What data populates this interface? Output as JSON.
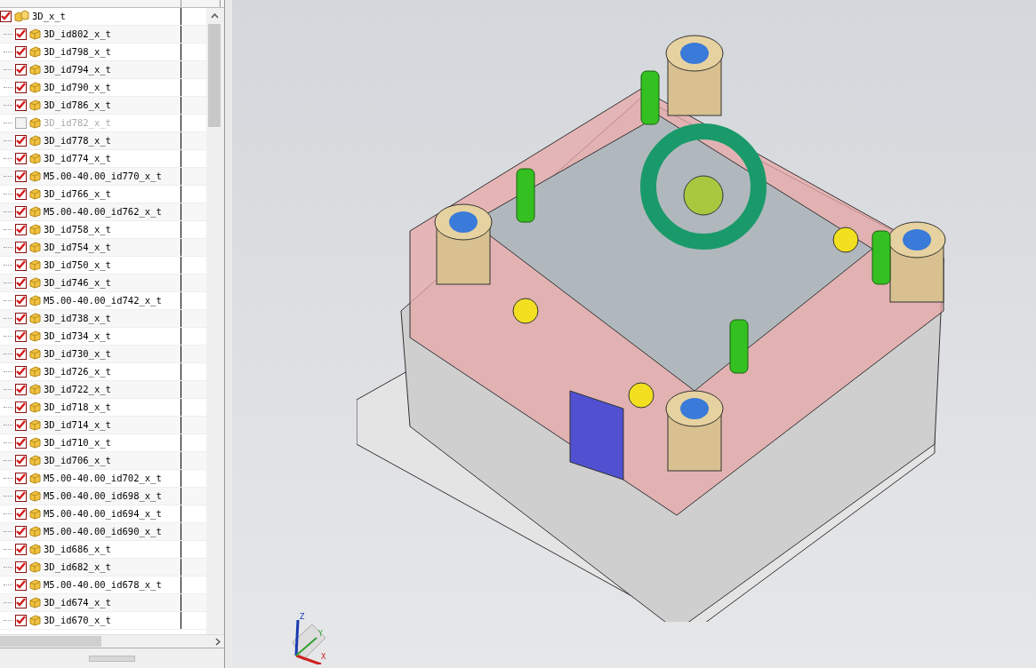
{
  "navigator": {
    "root": {
      "label": "3D_x_t",
      "checked": true,
      "children": [
        {
          "label": "3D_id802_x_t",
          "checked": true
        },
        {
          "label": "3D_id798_x_t",
          "checked": true
        },
        {
          "label": "3D_id794_x_t",
          "checked": true
        },
        {
          "label": "3D_id790_x_t",
          "checked": true
        },
        {
          "label": "3D_id786_x_t",
          "checked": true
        },
        {
          "label": "3D_id782_x_t",
          "checked": false
        },
        {
          "label": "3D_id778_x_t",
          "checked": true
        },
        {
          "label": "3D_id774_x_t",
          "checked": true
        },
        {
          "label": "M5.00-40.00_id770_x_t",
          "checked": true
        },
        {
          "label": "3D_id766_x_t",
          "checked": true
        },
        {
          "label": "M5.00-40.00_id762_x_t",
          "checked": true
        },
        {
          "label": "3D_id758_x_t",
          "checked": true
        },
        {
          "label": "3D_id754_x_t",
          "checked": true
        },
        {
          "label": "3D_id750_x_t",
          "checked": true
        },
        {
          "label": "3D_id746_x_t",
          "checked": true
        },
        {
          "label": "M5.00-40.00_id742_x_t",
          "checked": true
        },
        {
          "label": "3D_id738_x_t",
          "checked": true
        },
        {
          "label": "3D_id734_x_t",
          "checked": true
        },
        {
          "label": "3D_id730_x_t",
          "checked": true
        },
        {
          "label": "3D_id726_x_t",
          "checked": true
        },
        {
          "label": "3D_id722_x_t",
          "checked": true
        },
        {
          "label": "3D_id718_x_t",
          "checked": true
        },
        {
          "label": "3D_id714_x_t",
          "checked": true
        },
        {
          "label": "3D_id710_x_t",
          "checked": true
        },
        {
          "label": "3D_id706_x_t",
          "checked": true
        },
        {
          "label": "M5.00-40.00_id702_x_t",
          "checked": true
        },
        {
          "label": "M5.00-40.00_id698_x_t",
          "checked": true
        },
        {
          "label": "M5.00-40.00_id694_x_t",
          "checked": true
        },
        {
          "label": "M5.00-40.00_id690_x_t",
          "checked": true
        },
        {
          "label": "3D_id686_x_t",
          "checked": true
        },
        {
          "label": "3D_id682_x_t",
          "checked": true
        },
        {
          "label": "M5.00-40.00_id678_x_t",
          "checked": true
        },
        {
          "label": "3D_id674_x_t",
          "checked": true
        },
        {
          "label": "3D_id670_x_t",
          "checked": true
        }
      ]
    }
  },
  "viewport": {
    "axes": [
      "X",
      "Y",
      "Z"
    ]
  }
}
